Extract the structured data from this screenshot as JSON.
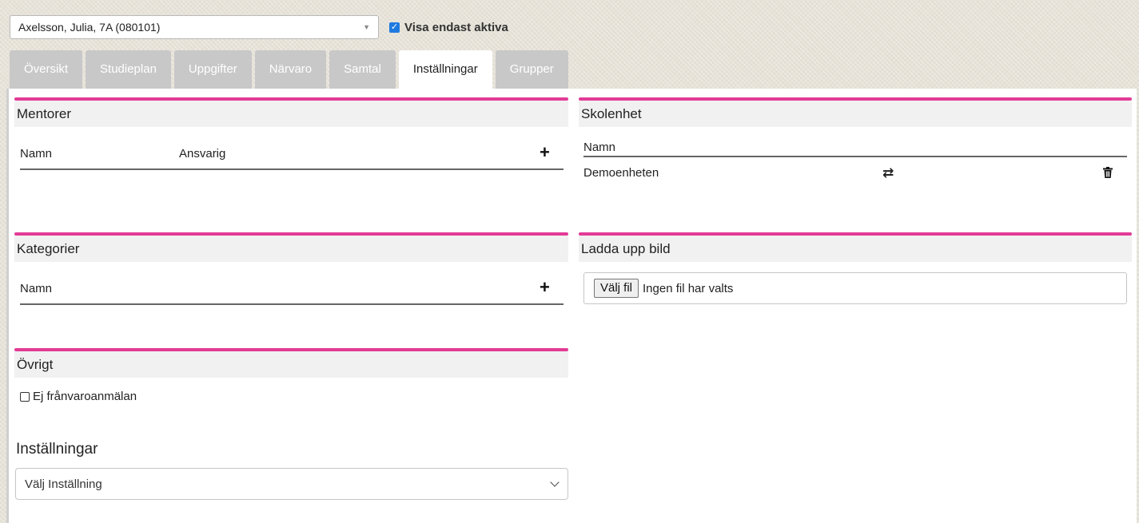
{
  "student_selector": {
    "value": "Axelsson, Julia, 7A (080101)"
  },
  "active_only": {
    "label": "Visa endast aktiva",
    "checked": true
  },
  "tabs": [
    {
      "label": "Översikt",
      "active": false
    },
    {
      "label": "Studieplan",
      "active": false
    },
    {
      "label": "Uppgifter",
      "active": false
    },
    {
      "label": "Närvaro",
      "active": false
    },
    {
      "label": "Samtal",
      "active": false
    },
    {
      "label": "Inställningar",
      "active": true
    },
    {
      "label": "Grupper",
      "active": false
    }
  ],
  "mentorer": {
    "title": "Mentorer",
    "col_name": "Namn",
    "col_responsible": "Ansvarig",
    "add_icon": "plus-icon"
  },
  "skolenhet": {
    "title": "Skolenhet",
    "col_name": "Namn",
    "rows": [
      {
        "name": "Demoenheten",
        "swap_icon": "swap-icon",
        "delete_icon": "trash-icon"
      }
    ]
  },
  "kategorier": {
    "title": "Kategorier",
    "col_name": "Namn",
    "add_icon": "plus-icon"
  },
  "ladda_upp": {
    "title": "Ladda upp bild",
    "button_label": "Välj fil",
    "status": "Ingen fil har valts"
  },
  "ovrigt": {
    "title": "Övrigt",
    "checkbox_label": "Ej frånvaroanmälan",
    "checked": false
  },
  "installningar": {
    "title": "Inställningar",
    "select_value": "Välj Inställning"
  },
  "colors": {
    "accent": "#e23b96",
    "tab_inactive": "#c8c8c8",
    "checkbox": "#1f7ae0"
  }
}
